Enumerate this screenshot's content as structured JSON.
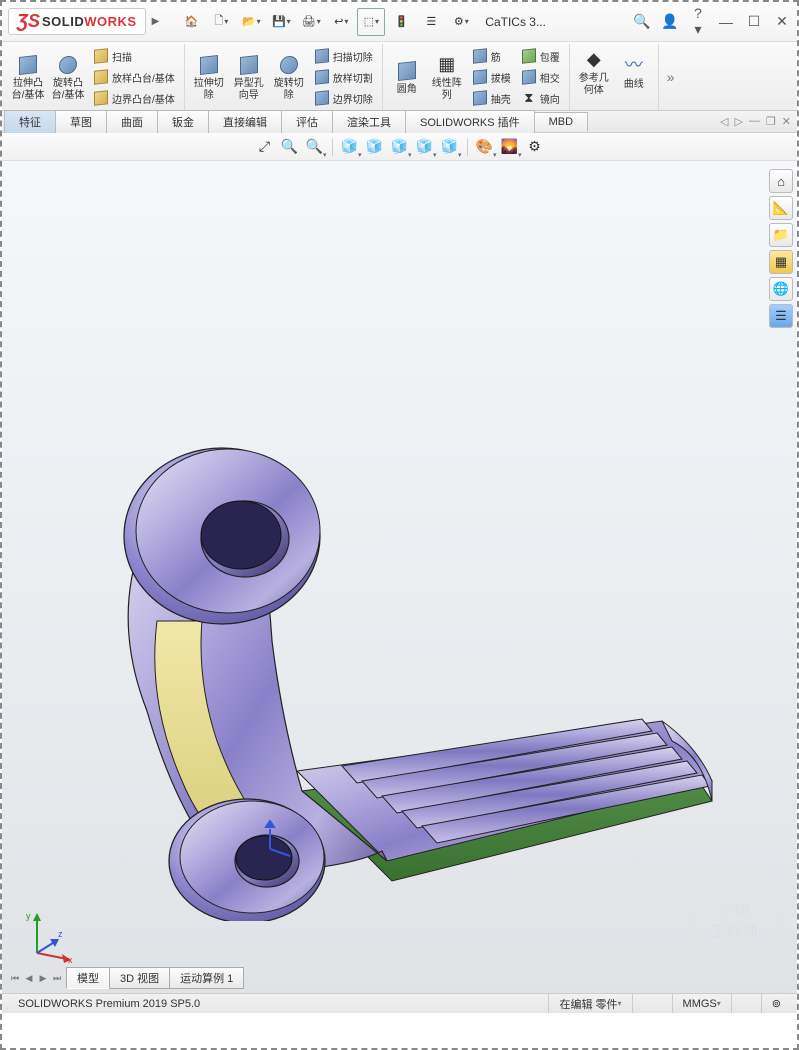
{
  "app": {
    "name_solid": "SOLID",
    "name_works": "WORKS",
    "doc_title": "CaTICs 3..."
  },
  "qat_icons": [
    "home",
    "new",
    "open",
    "save",
    "print",
    "undo",
    "select",
    "options",
    "settings",
    "gear"
  ],
  "ribbon": {
    "g1": {
      "extrude": "拉伸凸台/基体",
      "revolve": "旋转凸台/基体",
      "sweep": "扫描",
      "loft": "放样凸台/基体",
      "boundary": "边界凸台/基体"
    },
    "g2": {
      "cut_extrude": "拉伸切除",
      "hole": "异型孔向导",
      "cut_revolve": "旋转切除",
      "cut_sweep": "扫描切除",
      "cut_loft": "放样切割",
      "cut_boundary": "边界切除"
    },
    "g3": {
      "fillet": "圆角",
      "pattern": "线性阵列",
      "rib": "筋",
      "draft": "拔模",
      "shell": "抽壳",
      "wrap": "包覆",
      "intersect": "相交",
      "mirror": "镜向"
    },
    "g4": {
      "refgeom": "参考几何体",
      "curves": "曲线"
    }
  },
  "tabs": [
    "特征",
    "草图",
    "曲面",
    "钣金",
    "直接编辑",
    "评估",
    "渲染工具",
    "SOLIDWORKS 插件",
    "MBD"
  ],
  "active_tab": 0,
  "bottom_tabs": [
    "模型",
    "3D 视图",
    "运动算例 1"
  ],
  "active_bottom_tab": 0,
  "status": {
    "version": "SOLIDWORKS Premium 2019 SP5.0",
    "state": "在编辑 零件",
    "units": "MMGS"
  },
  "watermark": {
    "l1": "小 团",
    "l2": "工程师"
  },
  "triad": {
    "x": "x",
    "y": "y",
    "z": "z"
  },
  "side_icons": [
    "⌂",
    "📐",
    "📁",
    "▦",
    "🌐",
    "☰"
  ]
}
